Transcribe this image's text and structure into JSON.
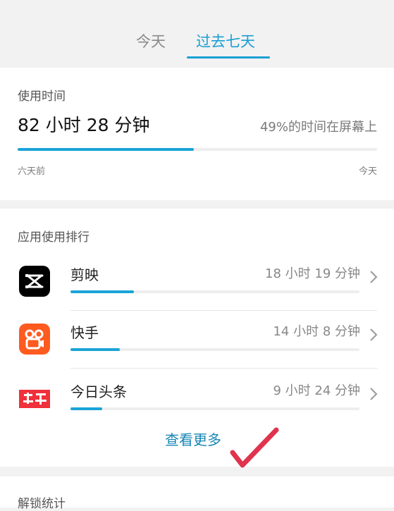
{
  "tabs": {
    "today": "今天",
    "week": "过去七天",
    "active": "week"
  },
  "usage": {
    "title": "使用时间",
    "total": "82 小时 28 分钟",
    "screen_share": "49%的时间在屏幕上",
    "progress_fraction": 0.49,
    "range_start": "六天前",
    "range_end": "今天"
  },
  "ranking": {
    "title": "应用使用排行",
    "apps": [
      {
        "name": "剪映",
        "time": "18 小时 19 分钟",
        "fraction": 0.22,
        "icon": "capcut-icon",
        "icon_color": "#000000"
      },
      {
        "name": "快手",
        "time": "14 小时 8 分钟",
        "fraction": 0.17,
        "icon": "kuaishou-icon",
        "icon_color": "#ff5a1f"
      },
      {
        "name": "今日头条",
        "time": "9 小时 24 分钟",
        "fraction": 0.11,
        "icon": "toutiao-icon",
        "icon_color": "#f0303a"
      }
    ],
    "more_label": "查看更多"
  },
  "unlock": {
    "title": "解锁统计"
  },
  "colors": {
    "accent": "#1aa3d6",
    "more_link": "#1686b5",
    "annotation": "#e0334d"
  }
}
